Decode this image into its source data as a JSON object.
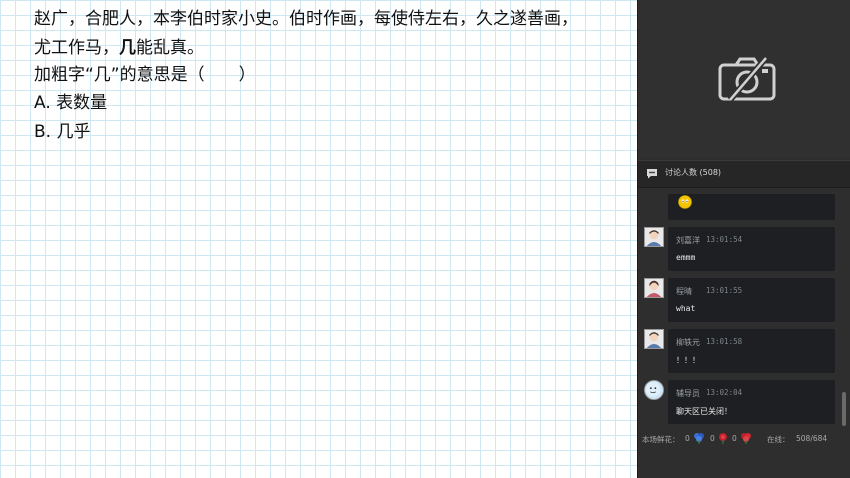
{
  "board": {
    "line1": "赵广，合肥人，本李伯时家小史。伯时作画，每使侍左右，久之遂善画，",
    "line2_pre": "尤工作马，",
    "line2_bold": "几",
    "line2_post": "能乱真。",
    "line3": "加粗字“几”的意思是（　　）",
    "option_a": "A. 表数量",
    "option_b": "B. 几乎"
  },
  "chat": {
    "header_title": "讨论人数 (508)",
    "messages": [
      {
        "name": "刘嘉洋",
        "time": "13:01:54",
        "text": "emmm"
      },
      {
        "name": "程晴",
        "time": "13:01:55",
        "text": "what"
      },
      {
        "name": "柳轶元",
        "time": "13:01:58",
        "text": "！！！"
      },
      {
        "name": "辅导员",
        "time": "13:02:04",
        "text": "聊天区已关闭！"
      }
    ]
  },
  "footer": {
    "label": "本场鲜花：",
    "count1": "0",
    "count2": "0",
    "count3": "0",
    "online_label": "在线：",
    "online_value": "508/684"
  },
  "icons": {
    "camera": "camera-off-icon",
    "chat": "chat-bubble-icon",
    "emoji": "emoji-face-icon",
    "flower_blue": "blue-flower-icon",
    "flower_red": "red-flower-icon"
  },
  "colors": {
    "panel_bg": "#2e2e2e",
    "card_bg": "#1d1f22",
    "grid_line": "#cfe6f3"
  }
}
